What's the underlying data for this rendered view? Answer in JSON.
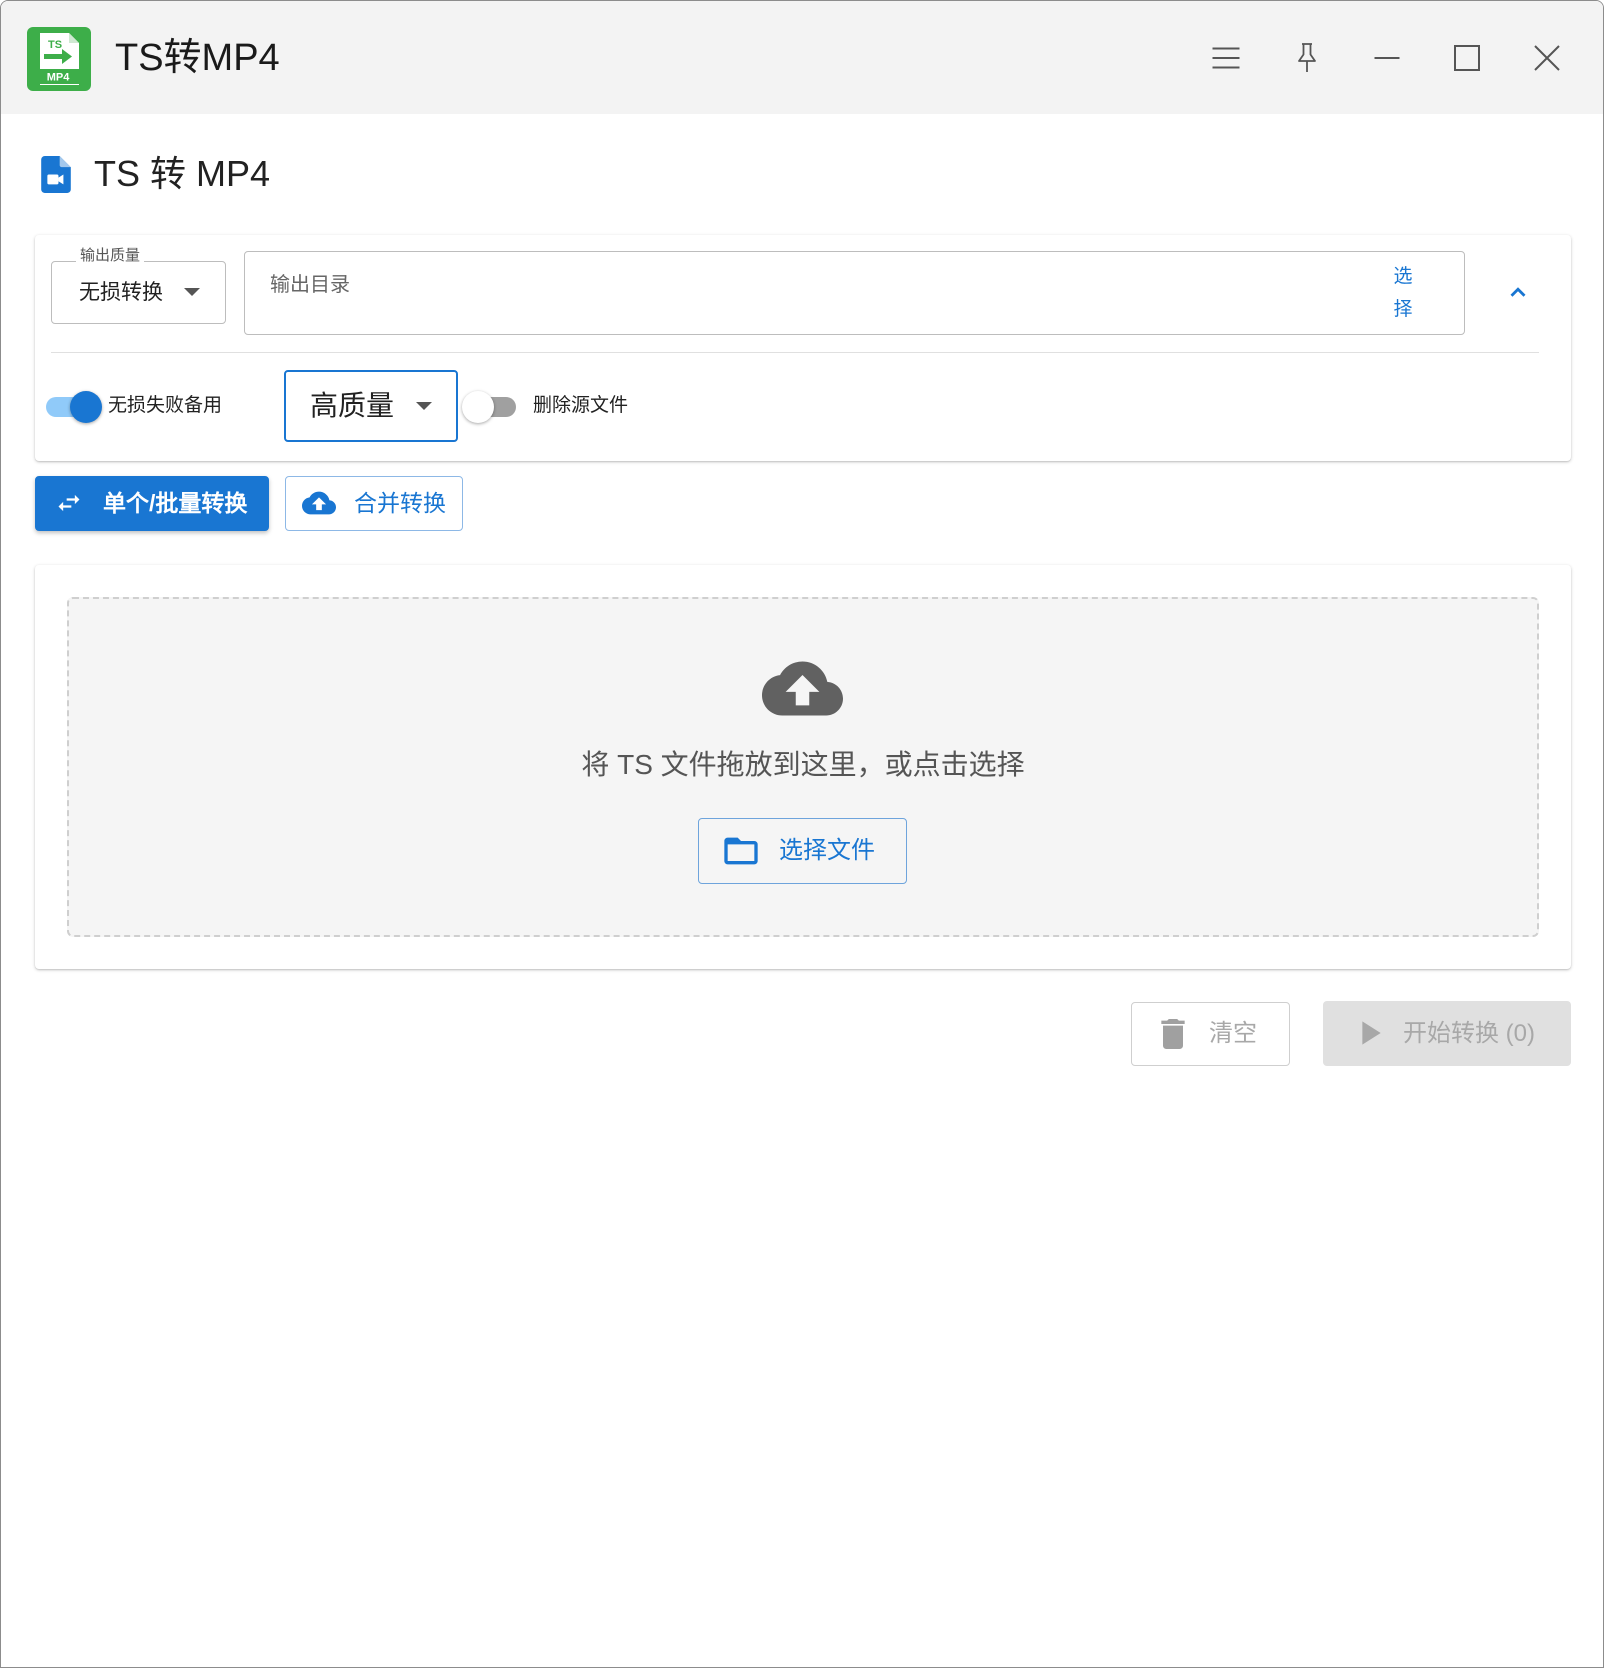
{
  "window": {
    "title": "TS转MP4",
    "logo_top": "TS",
    "logo_bottom": "MP4"
  },
  "page": {
    "title": "TS 转 MP4"
  },
  "settings": {
    "quality": {
      "label": "输出质量",
      "value": "无损转换"
    },
    "output_dir": {
      "placeholder": "输出目录",
      "value": "",
      "choose_label": "选择"
    },
    "fallback": {
      "label": "无损失败备用",
      "enabled": true,
      "quality": "高质量"
    },
    "delete_source": {
      "label": "删除源文件",
      "enabled": false
    }
  },
  "tabs": [
    {
      "label": "单个/批量转换",
      "icon": "swap-horizontal-icon",
      "active": true
    },
    {
      "label": "合并转换",
      "icon": "cloud-upload-icon",
      "active": false
    }
  ],
  "dropzone": {
    "icon": "cloud-upload-icon",
    "hint": "将 TS 文件拖放到这里，或点击选择",
    "button_label": "选择文件",
    "button_icon": "folder-icon"
  },
  "actions": {
    "clear_label": "清空",
    "clear_icon": "trash-icon",
    "start_label": "开始转换 (0)",
    "start_icon": "play-icon"
  },
  "colors": {
    "accent": "#1976d2",
    "titlebar_bg": "#f3f3f3",
    "logo_green": "#3dae49"
  }
}
